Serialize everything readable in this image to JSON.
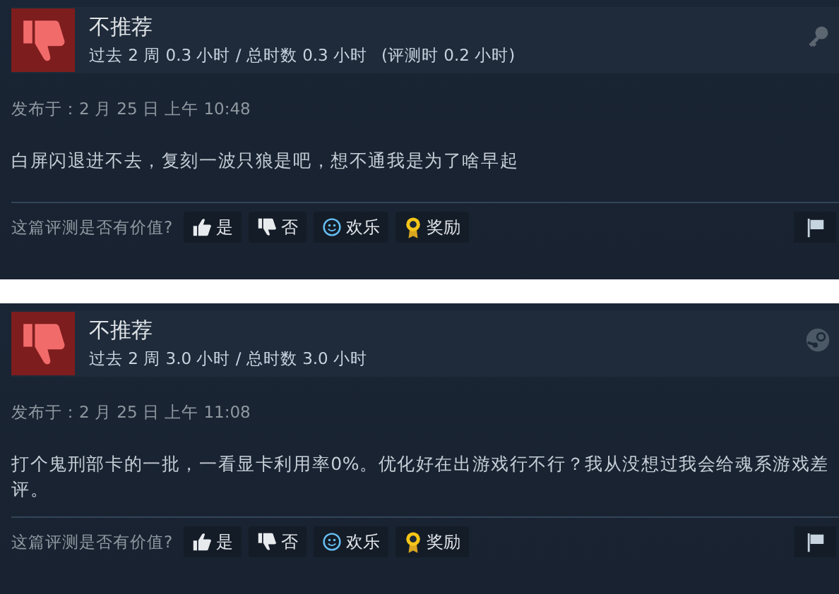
{
  "reviews": [
    {
      "recommended": false,
      "verdict": "不推荐",
      "playtime": "过去 2 周 0.3 小时 / 总时数 0.3 小时",
      "at_review": "(评测时 0.2 小时)",
      "source": {
        "kind": "key"
      },
      "posted": "发布于：2 月 25 日 上午 10:48",
      "body": "白屏闪退进不去，复刻一波只狼是吧，想不通我是为了啥早起",
      "helpful_prompt": "这篇评测是否有价值?",
      "buttons": [
        {
          "kind": "yes",
          "label": "是"
        },
        {
          "kind": "no",
          "label": "否"
        },
        {
          "kind": "funny",
          "label": "欢乐"
        },
        {
          "kind": "award",
          "label": "奖励"
        }
      ]
    },
    {
      "recommended": false,
      "verdict": "不推荐",
      "playtime": "过去 2 周 3.0 小时 / 总时数 3.0 小时",
      "source": {
        "kind": "steam"
      },
      "posted": "发布于：2 月 25 日 上午 11:08",
      "body": "打个鬼刑部卡的一批，一看显卡利用率0%。优化好在出游戏行不行？我从没想过我会给魂系游戏差评。",
      "helpful_prompt": "这篇评测是否有价值?",
      "buttons": [
        {
          "kind": "yes",
          "label": "是"
        },
        {
          "kind": "no",
          "label": "否"
        },
        {
          "kind": "funny",
          "label": "欢乐"
        },
        {
          "kind": "award",
          "label": "奖励"
        }
      ]
    }
  ]
}
